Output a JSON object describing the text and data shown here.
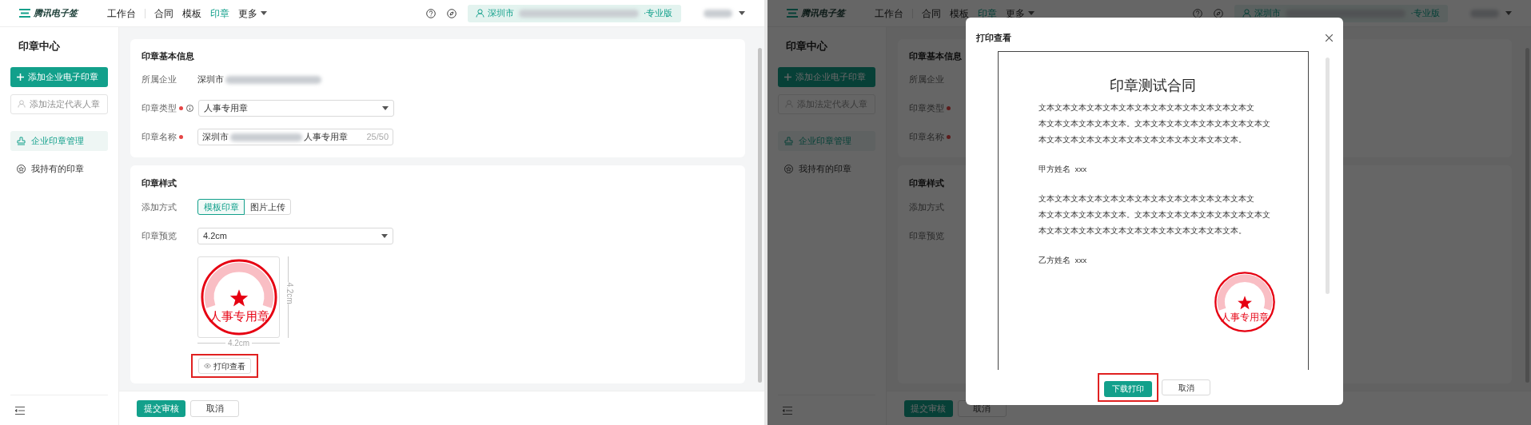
{
  "screens": [
    {
      "logo": "腾讯电子签",
      "nav": [
        {
          "label": "工作台",
          "selected": false,
          "dropdown": false
        },
        {
          "label": "合同",
          "selected": false,
          "dropdown": false
        },
        {
          "label": "模板",
          "selected": false,
          "dropdown": false
        },
        {
          "label": "印章",
          "selected": true,
          "dropdown": false
        },
        {
          "label": "更多",
          "selected": false,
          "dropdown": true
        }
      ],
      "org": {
        "name": "深圳市",
        "edition": "·专业版"
      },
      "sidebar": {
        "title": "印章中心",
        "primary_button": "添加企业电子印章",
        "secondary_button": {
          "label": "添加法定代表人章",
          "disabled": true
        },
        "items": [
          {
            "label": "企业印章管理",
            "selected": true
          },
          {
            "label": "我持有的印章",
            "selected": false
          }
        ]
      },
      "basic": {
        "title": "印章基本信息",
        "company": {
          "label": "所属企业",
          "value": "深圳市"
        },
        "type": {
          "label": "印章类型",
          "required": true,
          "value": "人事专用章"
        },
        "name": {
          "label": "印章名称",
          "required": true,
          "prefix": "深圳市",
          "suffix": "人事专用章",
          "count": "25/50"
        }
      },
      "style": {
        "title": "印章样式",
        "method": {
          "label": "添加方式",
          "options": [
            {
              "label": "模板印章",
              "selected": true
            },
            {
              "label": "图片上传",
              "selected": false
            }
          ]
        },
        "preview": {
          "label": "印章预览",
          "value": "4.2cm"
        },
        "seal": {
          "text": "人事专用章",
          "width": "4.2cm",
          "height": "4.2cm"
        },
        "print_button": {
          "label": "打印查看",
          "highlighted": true
        }
      },
      "footer": {
        "submit": "提交审核",
        "cancel": "取消"
      }
    },
    {
      "logo": "腾讯电子签",
      "nav": [
        {
          "label": "工作台",
          "selected": false,
          "dropdown": false
        },
        {
          "label": "合同",
          "selected": false,
          "dropdown": false
        },
        {
          "label": "模板",
          "selected": false,
          "dropdown": false
        },
        {
          "label": "印章",
          "selected": true,
          "dropdown": false
        },
        {
          "label": "更多",
          "selected": false,
          "dropdown": true
        }
      ],
      "org": {
        "name": "深圳市",
        "edition": "·专业版"
      },
      "sidebar": {
        "title": "印章中心",
        "primary_button": "添加企业电子印章",
        "secondary_button": {
          "label": "添加法定代表人章",
          "disabled": true
        },
        "items": [
          {
            "label": "企业印章管理",
            "selected": true
          },
          {
            "label": "我持有的印章",
            "selected": false
          }
        ]
      },
      "basic": {
        "title": "印章基本信息",
        "company": {
          "label": "所属企业"
        },
        "type": {
          "label": "印章类型",
          "required": true
        },
        "name": {
          "label": "印章名称",
          "required": true
        }
      },
      "style": {
        "title": "印章样式",
        "method": {
          "label": "添加方式"
        },
        "preview": {
          "label": "印章预览"
        }
      },
      "footer": {
        "submit": "提交审核",
        "cancel": "取消"
      },
      "dialog": {
        "title": "打印查看",
        "document": {
          "title": "印章测试合同",
          "blocks": [
            {
              "kind": "paragraph",
              "lines": [
                "文本文本文本文本文本文本文本文本文本文本文本文本文本文",
                "本文本文本文本文本文本。文本文本文本文本文本文本文本文本文",
                "本文本文本文本文本文本文本文本文本文本文本文本文本。"
              ]
            },
            {
              "kind": "party",
              "label": "甲方姓名",
              "value": "xxx"
            },
            {
              "kind": "paragraph",
              "lines": [
                "文本文本文本文本文本文本文本文本文本文本文本文本文本文",
                "本文本文本文本文本文本。文本文本文本文本文本文本文本文本文",
                "本文本文本文本文本文本文本文本文本文本文本文本文本。"
              ]
            },
            {
              "kind": "party",
              "label": "乙方姓名",
              "value": "xxx"
            }
          ],
          "seal": {
            "text": "人事专用章"
          }
        },
        "confirm": {
          "label": "下载打印",
          "highlighted": true
        },
        "cancel": "取消"
      }
    }
  ]
}
